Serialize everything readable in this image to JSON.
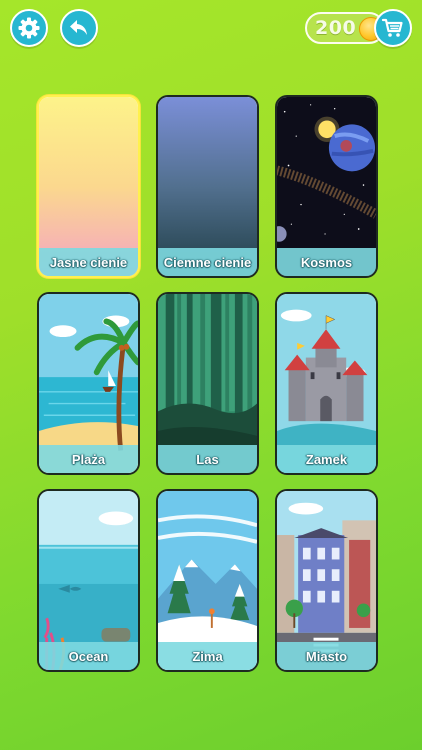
{
  "toolbar": {
    "settings_icon": "gear-icon",
    "back_icon": "undo-arrow-icon",
    "coins": "200",
    "cart_icon": "shopping-cart-icon"
  },
  "colors": {
    "background_top": "#a5e62a",
    "background_bottom": "#6ccf2d",
    "button": "#26b7d1",
    "label_bar": "#7dd9e0",
    "selected_border": "#fff14d"
  },
  "themes": [
    {
      "label": "Jasne cienie",
      "selected": true
    },
    {
      "label": "Ciemne cienie",
      "selected": false
    },
    {
      "label": "Kosmos",
      "selected": false
    },
    {
      "label": "Plaża",
      "selected": false
    },
    {
      "label": "Las",
      "selected": false
    },
    {
      "label": "Zamek",
      "selected": false
    },
    {
      "label": "Ocean",
      "selected": false
    },
    {
      "label": "Zima",
      "selected": false
    },
    {
      "label": "Miasto",
      "selected": false
    }
  ]
}
